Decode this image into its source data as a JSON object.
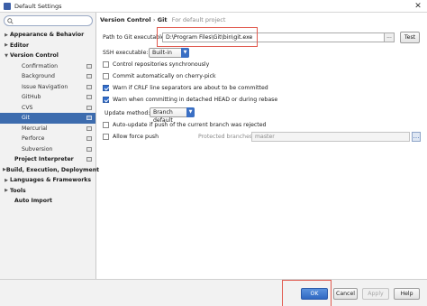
{
  "window": {
    "title": "Default Settings",
    "close_glyph": "✕"
  },
  "sidebar": {
    "search_placeholder": "",
    "items": [
      {
        "label": "Appearance & Behavior",
        "arrow": "▶"
      },
      {
        "label": "Editor",
        "arrow": "▶"
      },
      {
        "label": "Version Control",
        "arrow": "▼"
      },
      {
        "label": "Confirmation"
      },
      {
        "label": "Background"
      },
      {
        "label": "Issue Navigation"
      },
      {
        "label": "GitHub"
      },
      {
        "label": "CVS"
      },
      {
        "label": "Git"
      },
      {
        "label": "Mercurial"
      },
      {
        "label": "Perforce"
      },
      {
        "label": "Subversion"
      },
      {
        "label": "Project Interpreter"
      },
      {
        "label": "Build, Execution, Deployment",
        "arrow": "▶"
      },
      {
        "label": "Languages & Frameworks",
        "arrow": "▶"
      },
      {
        "label": "Tools",
        "arrow": "▶"
      },
      {
        "label": "Auto Import"
      }
    ]
  },
  "breadcrumb": {
    "parent": "Version Control",
    "separator": "›",
    "current": "Git",
    "note": "For default project"
  },
  "git": {
    "path_label": "Path to Git executable:",
    "path_value": "D:\\Program Files\\Git\\bin\\git.exe",
    "browse_label": "...",
    "test_label": "Test",
    "ssh_label": "SSH executable:",
    "ssh_value": "Built-in",
    "dropdown_glyph": "▼",
    "checkboxes": [
      {
        "label": "Control repositories synchronously",
        "checked": false
      },
      {
        "label": "Commit automatically on cherry-pick",
        "checked": false
      },
      {
        "label": "Warn if CRLF line separators are about to be committed",
        "checked": true
      },
      {
        "label": "Warn when committing in detached HEAD or during rebase",
        "checked": true
      }
    ],
    "update_method_label": "Update method:",
    "update_method_value": "Branch default",
    "auto_update_label": "Auto-update if push of the current branch was rejected",
    "auto_update_checked": false,
    "force_push_label": "Allow force push",
    "force_push_checked": false,
    "protected_branches_label": "Protected branches:",
    "protected_branches_value": "master",
    "protected_button_glyph": "…"
  },
  "footer": {
    "ok": "OK",
    "cancel": "Cancel",
    "apply": "Apply",
    "help": "Help"
  },
  "colors": {
    "selection": "#3d6cae",
    "accent": "#3a6fc4",
    "annotation": "#e15b50"
  }
}
